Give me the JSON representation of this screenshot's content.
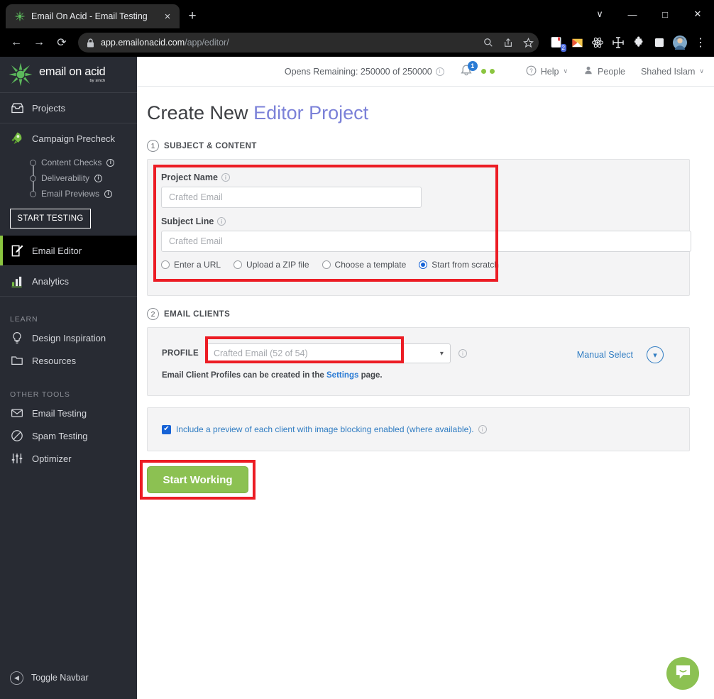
{
  "browser": {
    "tab": {
      "title": "Email On Acid - Email Testing",
      "favicon": "emailonacid-star-icon",
      "close": "×"
    },
    "new_tab": "+",
    "window_controls": {
      "minimize": "—",
      "maximize": "□",
      "close": "✕",
      "more": "∨"
    },
    "nav": {
      "back": "←",
      "forward": "→",
      "reload": "⟳"
    },
    "address": {
      "secure_icon": "lock-icon",
      "host": "app.emailonacid.com",
      "path": "/app/editor/"
    },
    "omnibox_icons": [
      "search-icon",
      "share-icon",
      "bookmark-star-icon"
    ],
    "extensions": [
      {
        "name": "reading-list-icon",
        "badge": "2"
      },
      {
        "name": "gmail-icon",
        "badge": ""
      },
      {
        "name": "react-devtools-icon",
        "badge": ""
      },
      {
        "name": "crosshair-icon",
        "badge": ""
      },
      {
        "name": "puzzle-extensions-icon",
        "badge": ""
      },
      {
        "name": "sidepanel-icon",
        "badge": ""
      },
      {
        "name": "profile-avatar",
        "badge": ""
      },
      {
        "name": "chrome-menu-icon",
        "badge": "⋮"
      }
    ]
  },
  "sidebar": {
    "logo": {
      "main": "email on acid",
      "sub": "by sinch",
      "icon": "green-splat-logo"
    },
    "items": [
      {
        "label": "Projects",
        "icon": "inbox-icon",
        "active": false
      },
      {
        "label": "Campaign Precheck",
        "icon": "rocket-icon",
        "active": false
      },
      {
        "label": "Email Editor",
        "icon": "pencil-square-icon",
        "active": true
      },
      {
        "label": "Analytics",
        "icon": "bar-chart-icon",
        "active": false
      }
    ],
    "precheck_sub": [
      {
        "label": "Content Checks",
        "info": "i"
      },
      {
        "label": "Deliverability",
        "info": "i"
      },
      {
        "label": "Email Previews",
        "info": "i"
      }
    ],
    "start_testing": "START TESTING",
    "learn_label": "LEARN",
    "learn_items": [
      {
        "label": "Design Inspiration",
        "icon": "lightbulb-icon"
      },
      {
        "label": "Resources",
        "icon": "folder-icon"
      }
    ],
    "other_tools_label": "OTHER TOOLS",
    "other_tools_items": [
      {
        "label": "Email Testing",
        "icon": "envelope-icon"
      },
      {
        "label": "Spam Testing",
        "icon": "no-entry-icon"
      },
      {
        "label": "Optimizer",
        "icon": "sliders-icon"
      }
    ],
    "toggle_navbar": "Toggle Navbar"
  },
  "topbar": {
    "opens_remaining": "Opens Remaining: 250000 of 250000",
    "opens_info": "i",
    "bell_badge": "1",
    "help": "Help",
    "people": "People",
    "user": "Shahed Islam",
    "chevron": "∨"
  },
  "page": {
    "title_prefix": "Create New ",
    "title_accent": "Editor Project"
  },
  "step1": {
    "number": "1",
    "label": "SUBJECT & CONTENT",
    "project_name_label": "Project Name",
    "project_name_info": "i",
    "project_name_placeholder": "Crafted Email",
    "project_name_value": "",
    "subject_line_label": "Subject Line",
    "subject_line_info": "i",
    "subject_line_placeholder": "Crafted Email",
    "subject_line_value": "",
    "source_options": [
      {
        "label": "Enter a URL",
        "selected": false
      },
      {
        "label": "Upload a ZIP file",
        "selected": false
      },
      {
        "label": "Choose a template",
        "selected": false
      },
      {
        "label": "Start from scratch",
        "selected": true
      }
    ]
  },
  "step2": {
    "number": "2",
    "label": "EMAIL CLIENTS",
    "profile_label": "PROFILE",
    "profile_value": "Crafted Email (52 of 54)",
    "profile_info": "i",
    "note_prefix": "Email Client Profiles can be created in the ",
    "note_link": "Settings",
    "note_suffix": " page.",
    "manual_select": "Manual Select",
    "manual_chevron": "∨"
  },
  "step3": {
    "checkbox_checked": true,
    "checkbox_mark": "✔",
    "checkbox_label": "Include a preview of each client with image blocking enabled (where available).",
    "checkbox_info": "i"
  },
  "cta": {
    "label": "Start Working"
  },
  "intercom": {
    "icon": "chat-smile-icon"
  },
  "colors": {
    "brand_green": "#8bc540",
    "cta_green": "#8cc152",
    "accent_purple": "#7b81d8",
    "link_blue": "#2f7cc2",
    "radio_blue": "#1763d6",
    "highlight_red": "#ec1c24",
    "sidebar_bg": "#282b33",
    "panel_bg": "#f4f4f5"
  }
}
